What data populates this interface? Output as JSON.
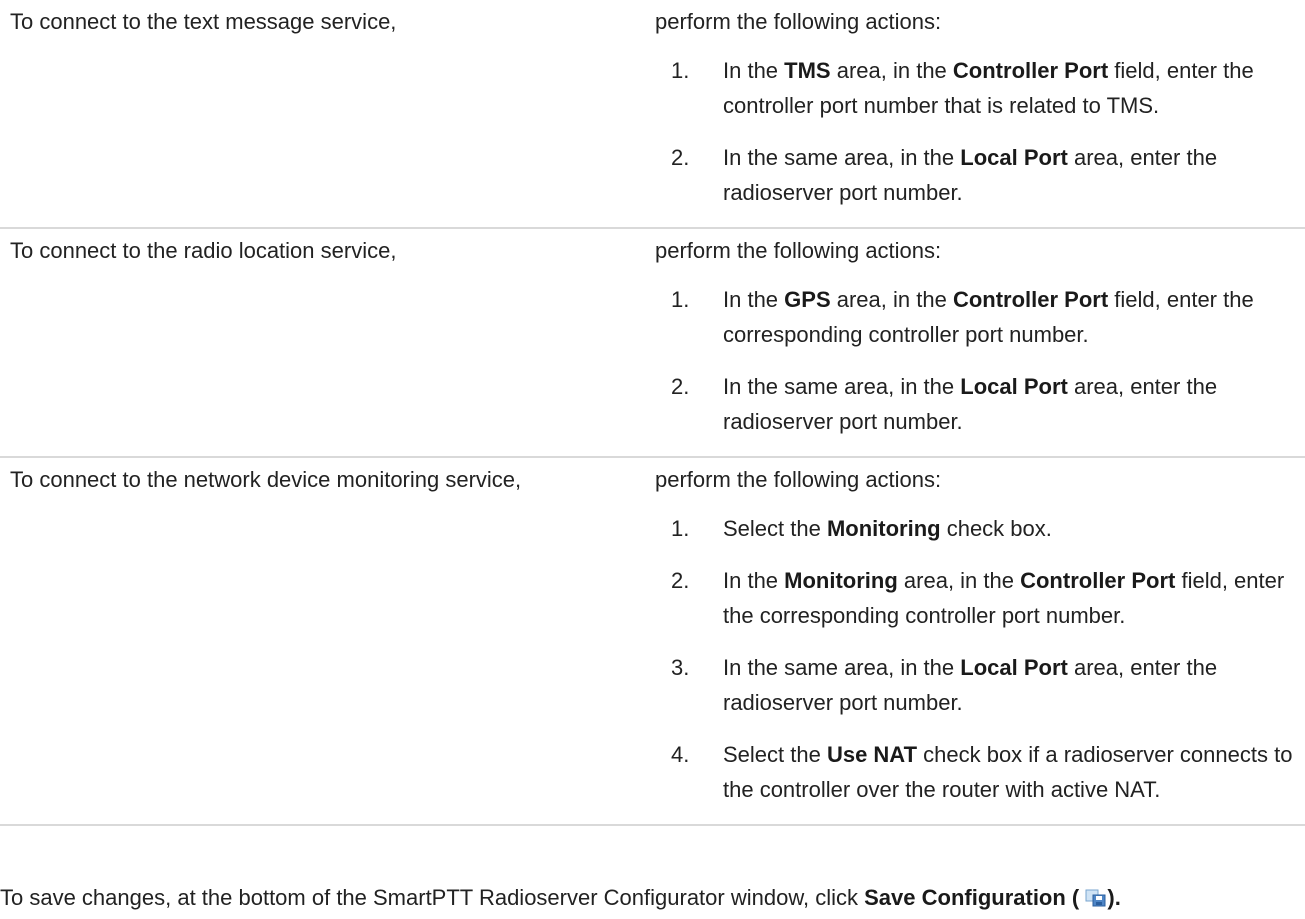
{
  "rows": [
    {
      "condition": "To connect to the text message service,",
      "lead": "perform the following actions:",
      "steps": [
        {
          "n": "1.",
          "parts": [
            {
              "t": "In the "
            },
            {
              "t": "TMS",
              "b": true
            },
            {
              "t": " area, in the "
            },
            {
              "t": "Controller Port",
              "b": true
            },
            {
              "t": " field, enter the controller port number that is related to TMS."
            }
          ]
        },
        {
          "n": "2.",
          "parts": [
            {
              "t": "In the same area, in the "
            },
            {
              "t": "Local Port",
              "b": true
            },
            {
              "t": " area, enter the radioserver port number."
            }
          ]
        }
      ]
    },
    {
      "condition": "To connect to the radio location service,",
      "lead": "perform the following actions:",
      "steps": [
        {
          "n": "1.",
          "parts": [
            {
              "t": "In the "
            },
            {
              "t": "GPS",
              "b": true
            },
            {
              "t": " area, in the "
            },
            {
              "t": "Controller Port",
              "b": true
            },
            {
              "t": " field, enter the corresponding controller port number."
            }
          ]
        },
        {
          "n": "2.",
          "parts": [
            {
              "t": "In the same area, in the "
            },
            {
              "t": "Local Port",
              "b": true
            },
            {
              "t": " area, enter the radioserver port number."
            }
          ]
        }
      ]
    },
    {
      "condition": "To connect to the network device monitoring service,",
      "lead": "perform the following actions:",
      "steps": [
        {
          "n": "1.",
          "parts": [
            {
              "t": "Select the "
            },
            {
              "t": "Monitoring",
              "b": true
            },
            {
              "t": " check box."
            }
          ]
        },
        {
          "n": "2.",
          "parts": [
            {
              "t": "In the "
            },
            {
              "t": "Monitoring",
              "b": true
            },
            {
              "t": " area, in the "
            },
            {
              "t": "Controller Port",
              "b": true
            },
            {
              "t": " field, enter the corresponding controller port number."
            }
          ]
        },
        {
          "n": "3.",
          "parts": [
            {
              "t": "In the same area, in the "
            },
            {
              "t": "Local Port",
              "b": true
            },
            {
              "t": " area, enter the radioserver port number."
            }
          ]
        },
        {
          "n": "4.",
          "parts": [
            {
              "t": "Select the "
            },
            {
              "t": "Use NAT",
              "b": true
            },
            {
              "t": " check box if a radioserver connects to the controller over the router with active NAT."
            }
          ]
        }
      ]
    }
  ],
  "footer": {
    "prefix": "To save changes, at the bottom of the SmartPTT Radioserver Configurator window, click ",
    "button_label": "Save Configuration (",
    "suffix": ").",
    "icon": "save-configuration-icon"
  }
}
